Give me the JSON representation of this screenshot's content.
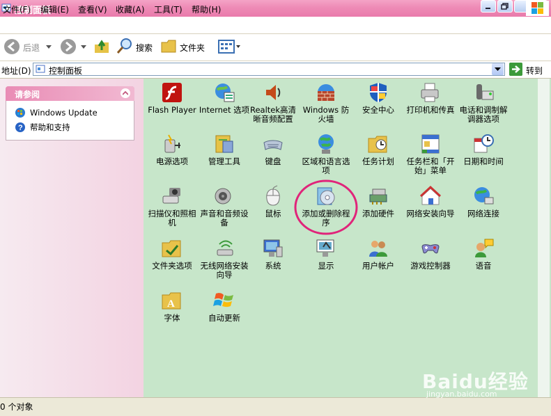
{
  "window": {
    "title": "控制面板"
  },
  "menu": [
    "文件(F)",
    "编辑(E)",
    "查看(V)",
    "收藏(A)",
    "工具(T)",
    "帮助(H)"
  ],
  "toolbar": {
    "back": "后退",
    "search": "搜索",
    "folders": "文件夹"
  },
  "address": {
    "label": "地址(D)",
    "value": "控制面板",
    "go": "转到"
  },
  "see_also": {
    "title": "请参阅",
    "items": [
      {
        "label": "Windows Update",
        "icon": "windows-update-icon"
      },
      {
        "label": "帮助和支持",
        "icon": "help-icon"
      }
    ]
  },
  "items": [
    {
      "label": "Flash Player",
      "icon": "flash-icon"
    },
    {
      "label": "Internet 选项",
      "icon": "internet-options-icon"
    },
    {
      "label": "Realtek高清晰音频配置",
      "icon": "realtek-audio-icon"
    },
    {
      "label": "Windows 防火墙",
      "icon": "firewall-icon"
    },
    {
      "label": "安全中心",
      "icon": "security-center-icon"
    },
    {
      "label": "打印机和传真",
      "icon": "printer-icon"
    },
    {
      "label": "电话和调制解调器选项",
      "icon": "phone-modem-icon"
    },
    {
      "label": "电源选项",
      "icon": "power-icon"
    },
    {
      "label": "管理工具",
      "icon": "admin-tools-icon"
    },
    {
      "label": "键盘",
      "icon": "keyboard-icon"
    },
    {
      "label": "区域和语言选项",
      "icon": "region-language-icon"
    },
    {
      "label": "任务计划",
      "icon": "scheduled-tasks-icon"
    },
    {
      "label": "任务栏和「开始」菜单",
      "icon": "taskbar-icon"
    },
    {
      "label": "日期和时间",
      "icon": "date-time-icon"
    },
    {
      "label": "扫描仪和照相机",
      "icon": "scanner-icon"
    },
    {
      "label": "声音和音频设备",
      "icon": "sound-icon"
    },
    {
      "label": "鼠标",
      "icon": "mouse-icon"
    },
    {
      "label": "添加或删除程序",
      "icon": "add-remove-programs-icon"
    },
    {
      "label": "添加硬件",
      "icon": "add-hardware-icon"
    },
    {
      "label": "网络安装向导",
      "icon": "network-setup-icon"
    },
    {
      "label": "网络连接",
      "icon": "network-connections-icon"
    },
    {
      "label": "文件夹选项",
      "icon": "folder-options-icon"
    },
    {
      "label": "无线网络安装向导",
      "icon": "wireless-setup-icon"
    },
    {
      "label": "系统",
      "icon": "system-icon"
    },
    {
      "label": "显示",
      "icon": "display-icon"
    },
    {
      "label": "用户帐户",
      "icon": "user-accounts-icon"
    },
    {
      "label": "游戏控制器",
      "icon": "game-controller-icon"
    },
    {
      "label": "语音",
      "icon": "speech-icon"
    },
    {
      "label": "字体",
      "icon": "fonts-icon"
    },
    {
      "label": "自动更新",
      "icon": "auto-update-icon"
    }
  ],
  "status": {
    "text": "0 个对象"
  },
  "watermark": {
    "brand": "Baidu经验",
    "url": "jingyan.baidu.com"
  }
}
